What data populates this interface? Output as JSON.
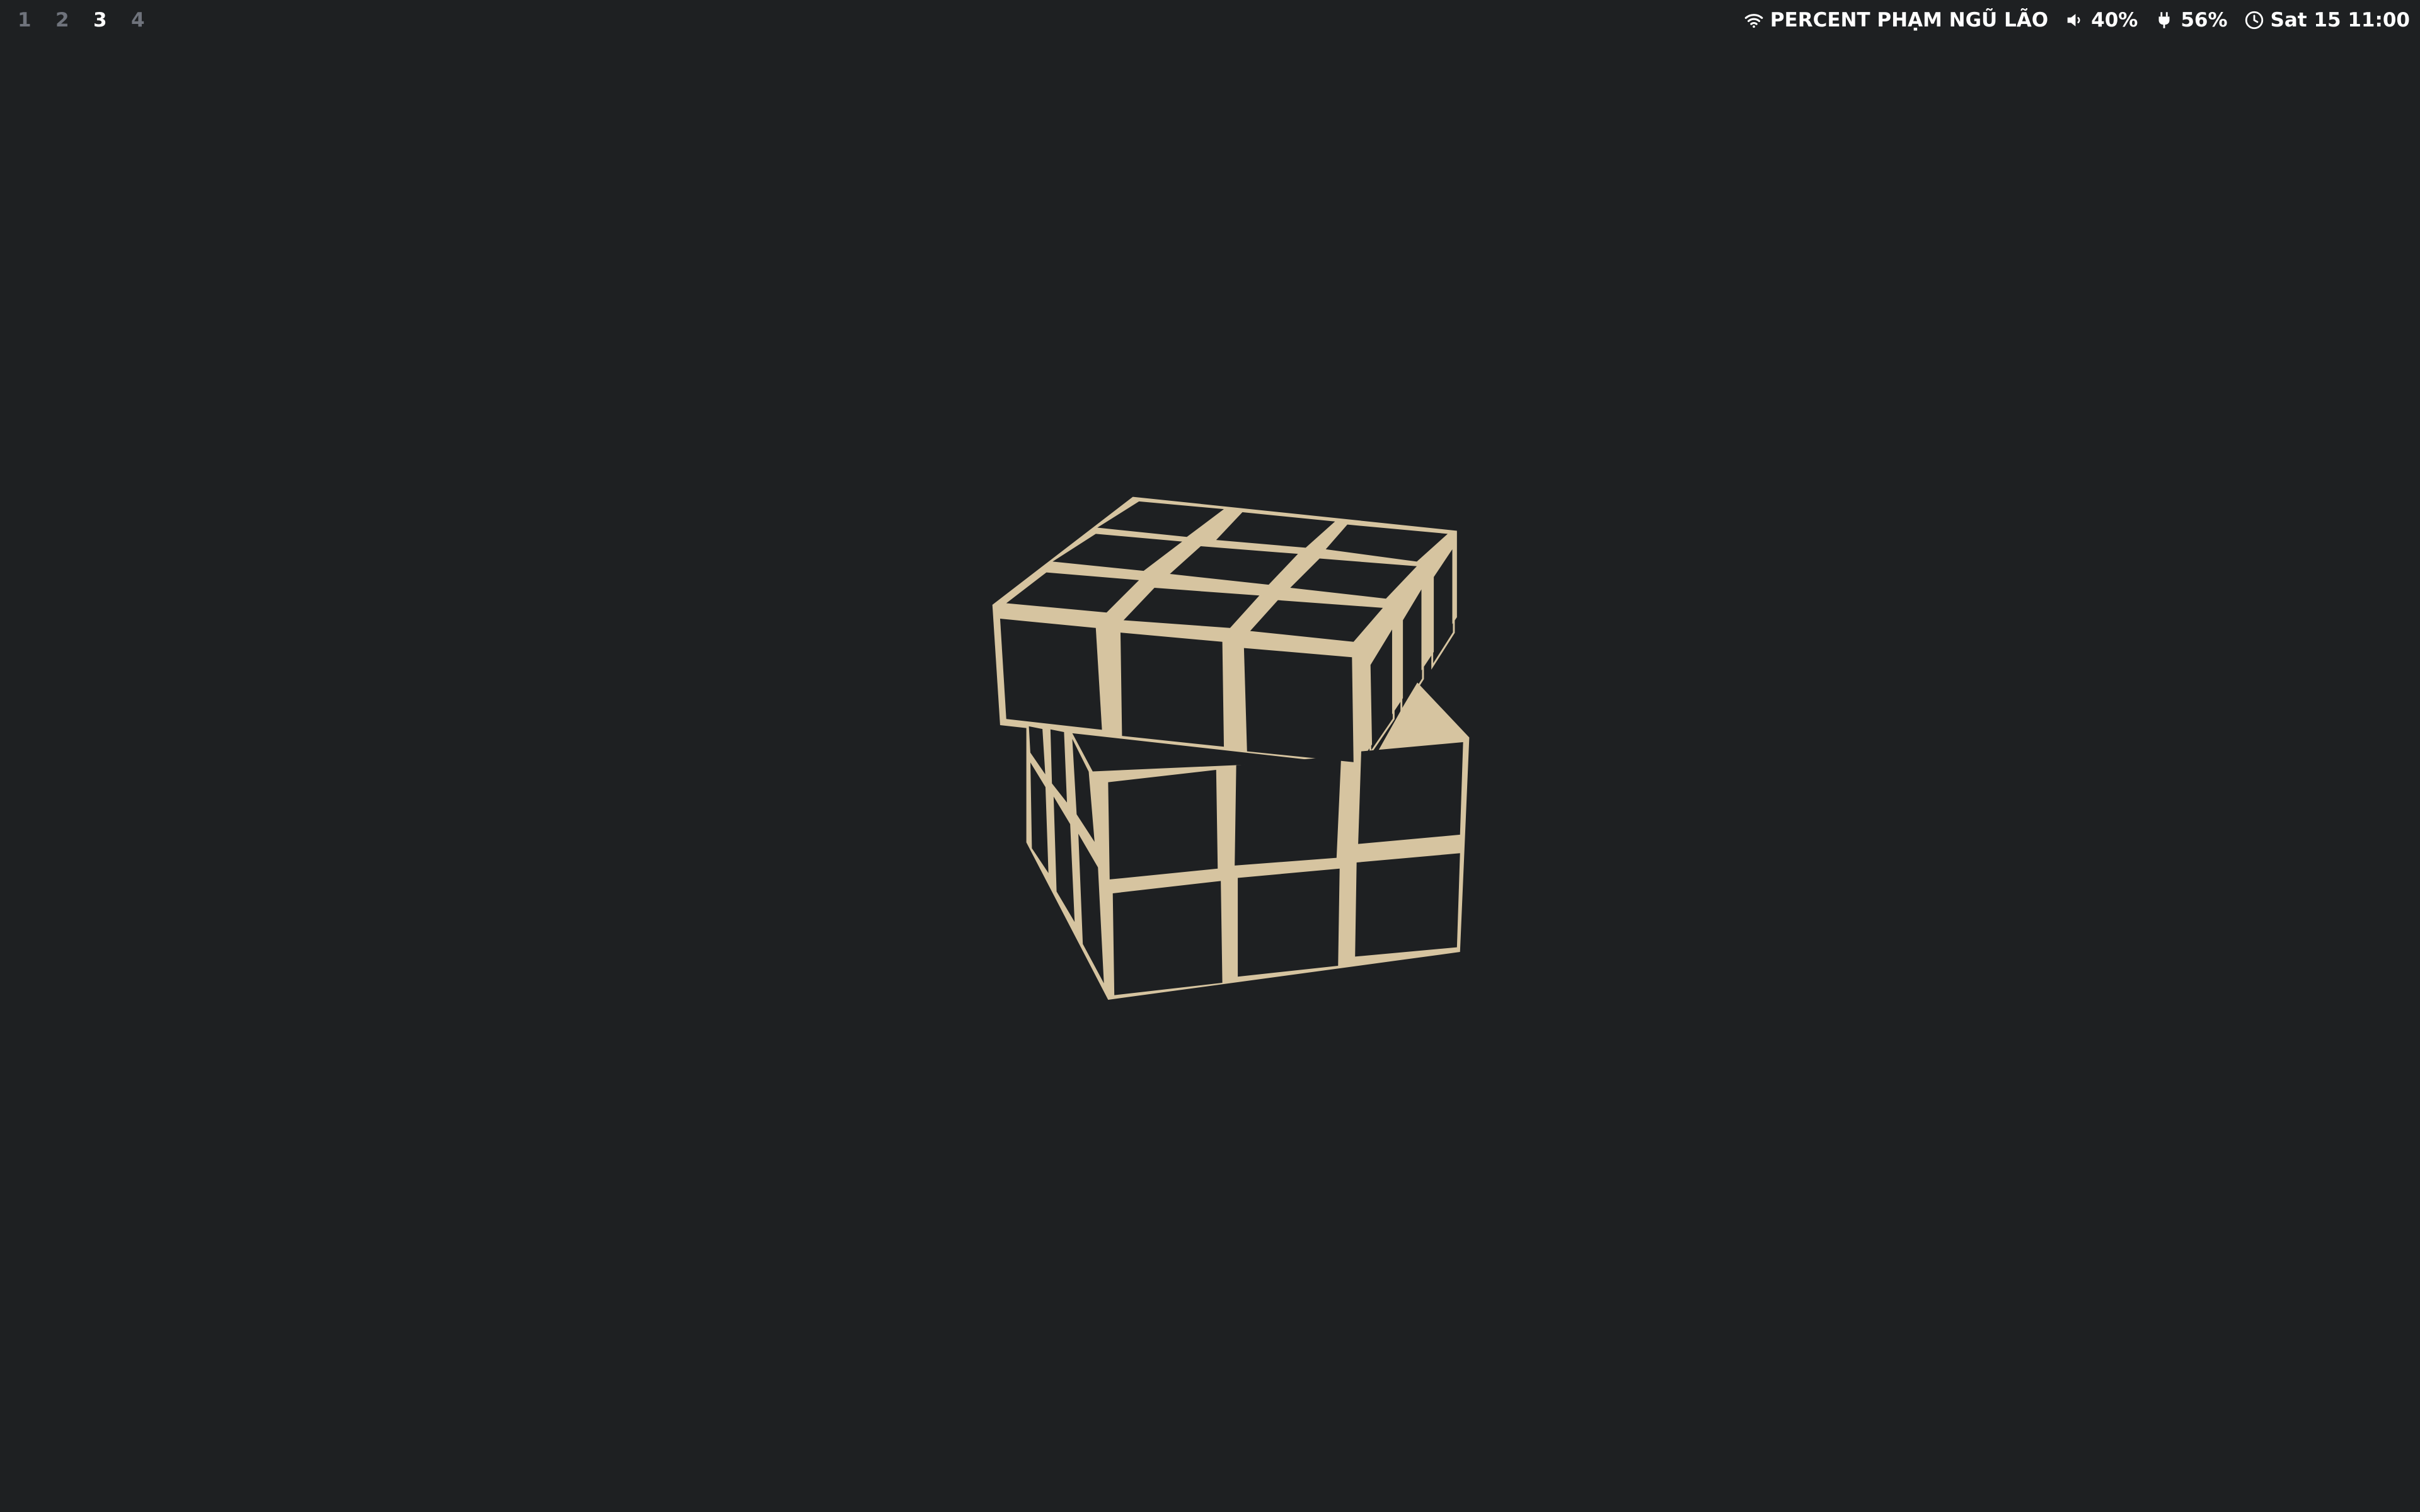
{
  "workspaces": [
    {
      "label": "1",
      "active": false
    },
    {
      "label": "2",
      "active": false
    },
    {
      "label": "3",
      "active": true
    },
    {
      "label": "4",
      "active": false
    }
  ],
  "status": {
    "wifi": {
      "icon": "wifi-icon",
      "label": "PERCENT PHẠM NGŨ LÃO"
    },
    "volume": {
      "icon": "volume-icon",
      "label": "40%"
    },
    "battery": {
      "icon": "power-plug-icon",
      "label": "56%"
    },
    "clock": {
      "icon": "clock-icon",
      "label": "Sat 15 11:00"
    }
  },
  "wallpaper": {
    "subject": "rubiks-cube-outline",
    "background_color": "#1e2022",
    "cube_color": "#d6c4a0"
  }
}
